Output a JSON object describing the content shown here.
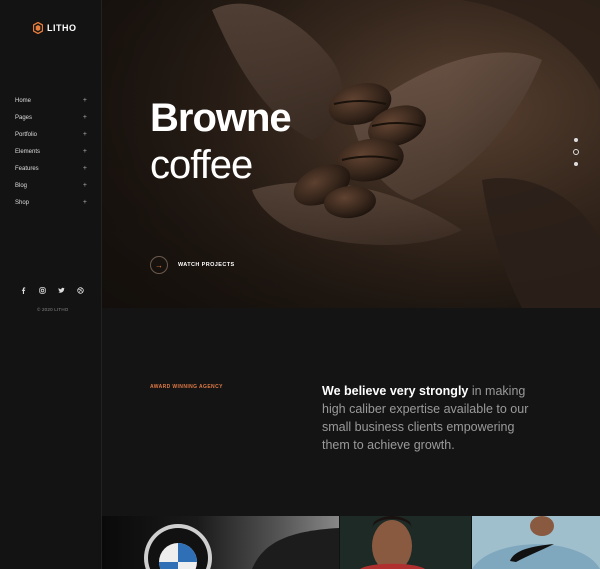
{
  "brand": {
    "name": "LITHO",
    "accent": "#e57c3c"
  },
  "nav": {
    "items": [
      {
        "label": "Home",
        "toggle": "+"
      },
      {
        "label": "Pages",
        "toggle": "+"
      },
      {
        "label": "Portfolio",
        "toggle": "+"
      },
      {
        "label": "Elements",
        "toggle": "+"
      },
      {
        "label": "Features",
        "toggle": "+"
      },
      {
        "label": "Blog",
        "toggle": "+"
      },
      {
        "label": "Shop",
        "toggle": "+"
      }
    ]
  },
  "social": {
    "icons": [
      "facebook-icon",
      "instagram-icon",
      "twitter-icon",
      "dribbble-icon"
    ]
  },
  "footer": {
    "copyright": "© 2020 LITHO"
  },
  "hero": {
    "title_bold": "Browne",
    "title_light": "coffee",
    "cta_label": "WATCH PROJECTS",
    "cta_icon": "arrow-right-icon",
    "slides": 3,
    "active_slide": 2
  },
  "about": {
    "eyebrow": "AWARD WINNING AGENCY",
    "lead_bold": "We believe very strongly",
    "lead_rest": " in making high caliber expertise available to our small business clients empowering them to achieve growth."
  }
}
